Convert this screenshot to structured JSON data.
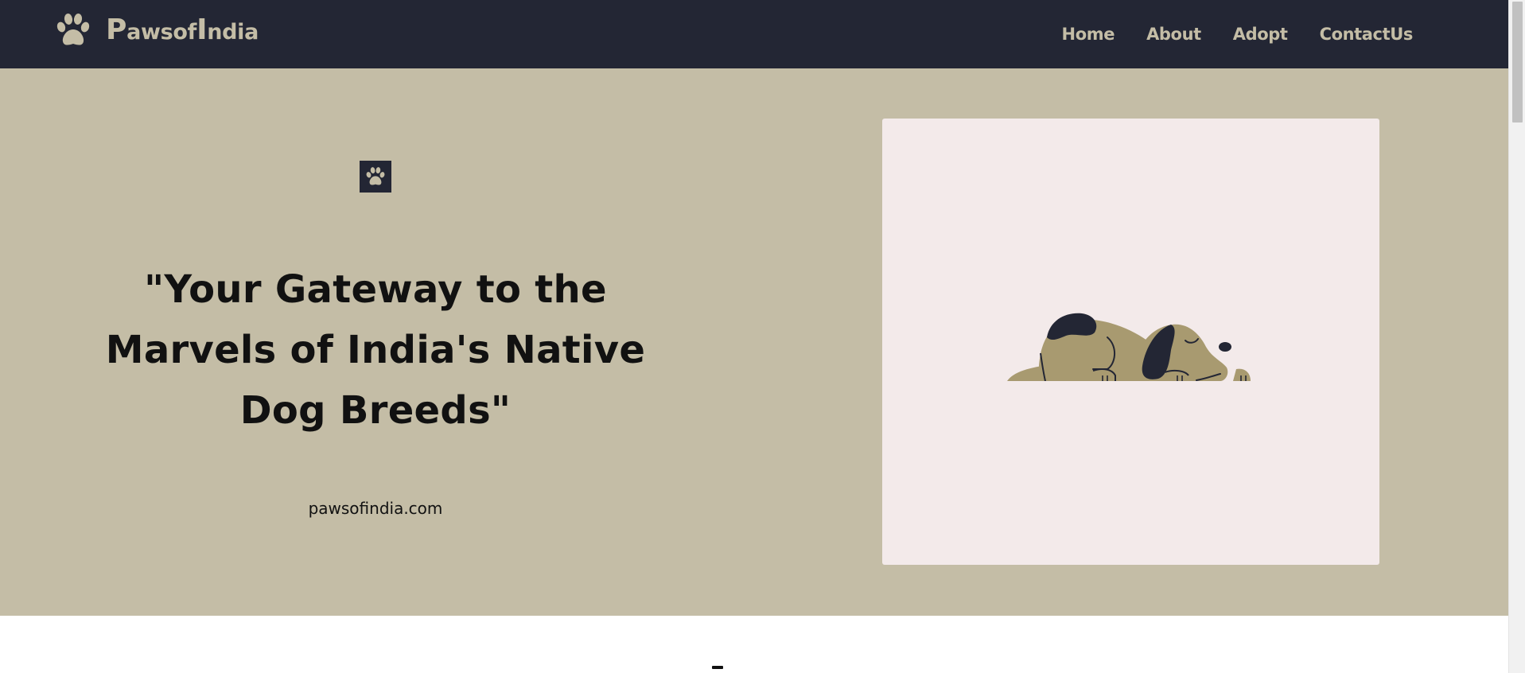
{
  "brand": {
    "initial_p": "P",
    "part1": "awsof",
    "initial_i": "I",
    "part2": "ndia",
    "logo_icon": "paw-icon",
    "color": "#c4bda6"
  },
  "nav": {
    "items": [
      {
        "label": "Home"
      },
      {
        "label": "About"
      },
      {
        "label": "Adopt"
      },
      {
        "label": "ContactUs"
      }
    ],
    "background": "#232634",
    "text_color": "#c4bda6"
  },
  "hero": {
    "badge_icon": "paw-icon",
    "title": "\"Your Gateway to the Marvels of India's Native Dog Breeds\"",
    "site": "pawsofindia.com",
    "illustration": "sleeping-dog-illustration",
    "background": "#c4bda6",
    "card_background": "#f3eaea",
    "title_color": "#111111"
  }
}
